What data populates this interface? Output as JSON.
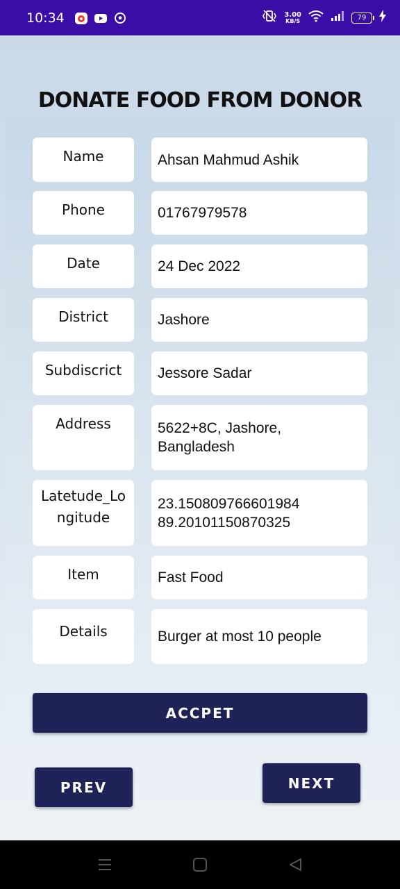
{
  "status_bar": {
    "time": "10:34",
    "net_speed_value": "3.00",
    "net_speed_unit": "KB/S",
    "battery": "79",
    "app_icons": [
      "record-icon",
      "youtube-icon",
      "football-icon"
    ],
    "right_icons": [
      "vibrate-icon",
      "wifi-icon",
      "signal-icon",
      "battery-icon",
      "charging-icon"
    ]
  },
  "page": {
    "title": "DONATE FOOD FROM DONOR"
  },
  "form": {
    "rows": [
      {
        "label": "Name",
        "value": "Ahsan Mahmud Ashik"
      },
      {
        "label": "Phone",
        "value": "01767979578"
      },
      {
        "label": "Date",
        "value": "24 Dec 2022"
      },
      {
        "label": "District",
        "value": "Jashore"
      },
      {
        "label": "Subdiscrict",
        "value": "Jessore Sadar"
      },
      {
        "label": "Address",
        "value": "5622+8C, Jashore, Bangladesh"
      },
      {
        "label": "Latetude_Longitude",
        "value": "23.150809766601984 89.20101150870325"
      },
      {
        "label": "Item",
        "value": "Fast Food"
      },
      {
        "label": "Details",
        "value": "Burger at most 10 people"
      }
    ]
  },
  "actions": {
    "accept_label": "ACCPET",
    "prev_label": "PREV",
    "next_label": "NEXT"
  },
  "colors": {
    "status_bar": "#3a0ea6",
    "button": "#1f2257",
    "background": "#cfdce9"
  },
  "nav_bar": {
    "icons": [
      "menu-icon",
      "home-icon",
      "back-icon"
    ]
  }
}
